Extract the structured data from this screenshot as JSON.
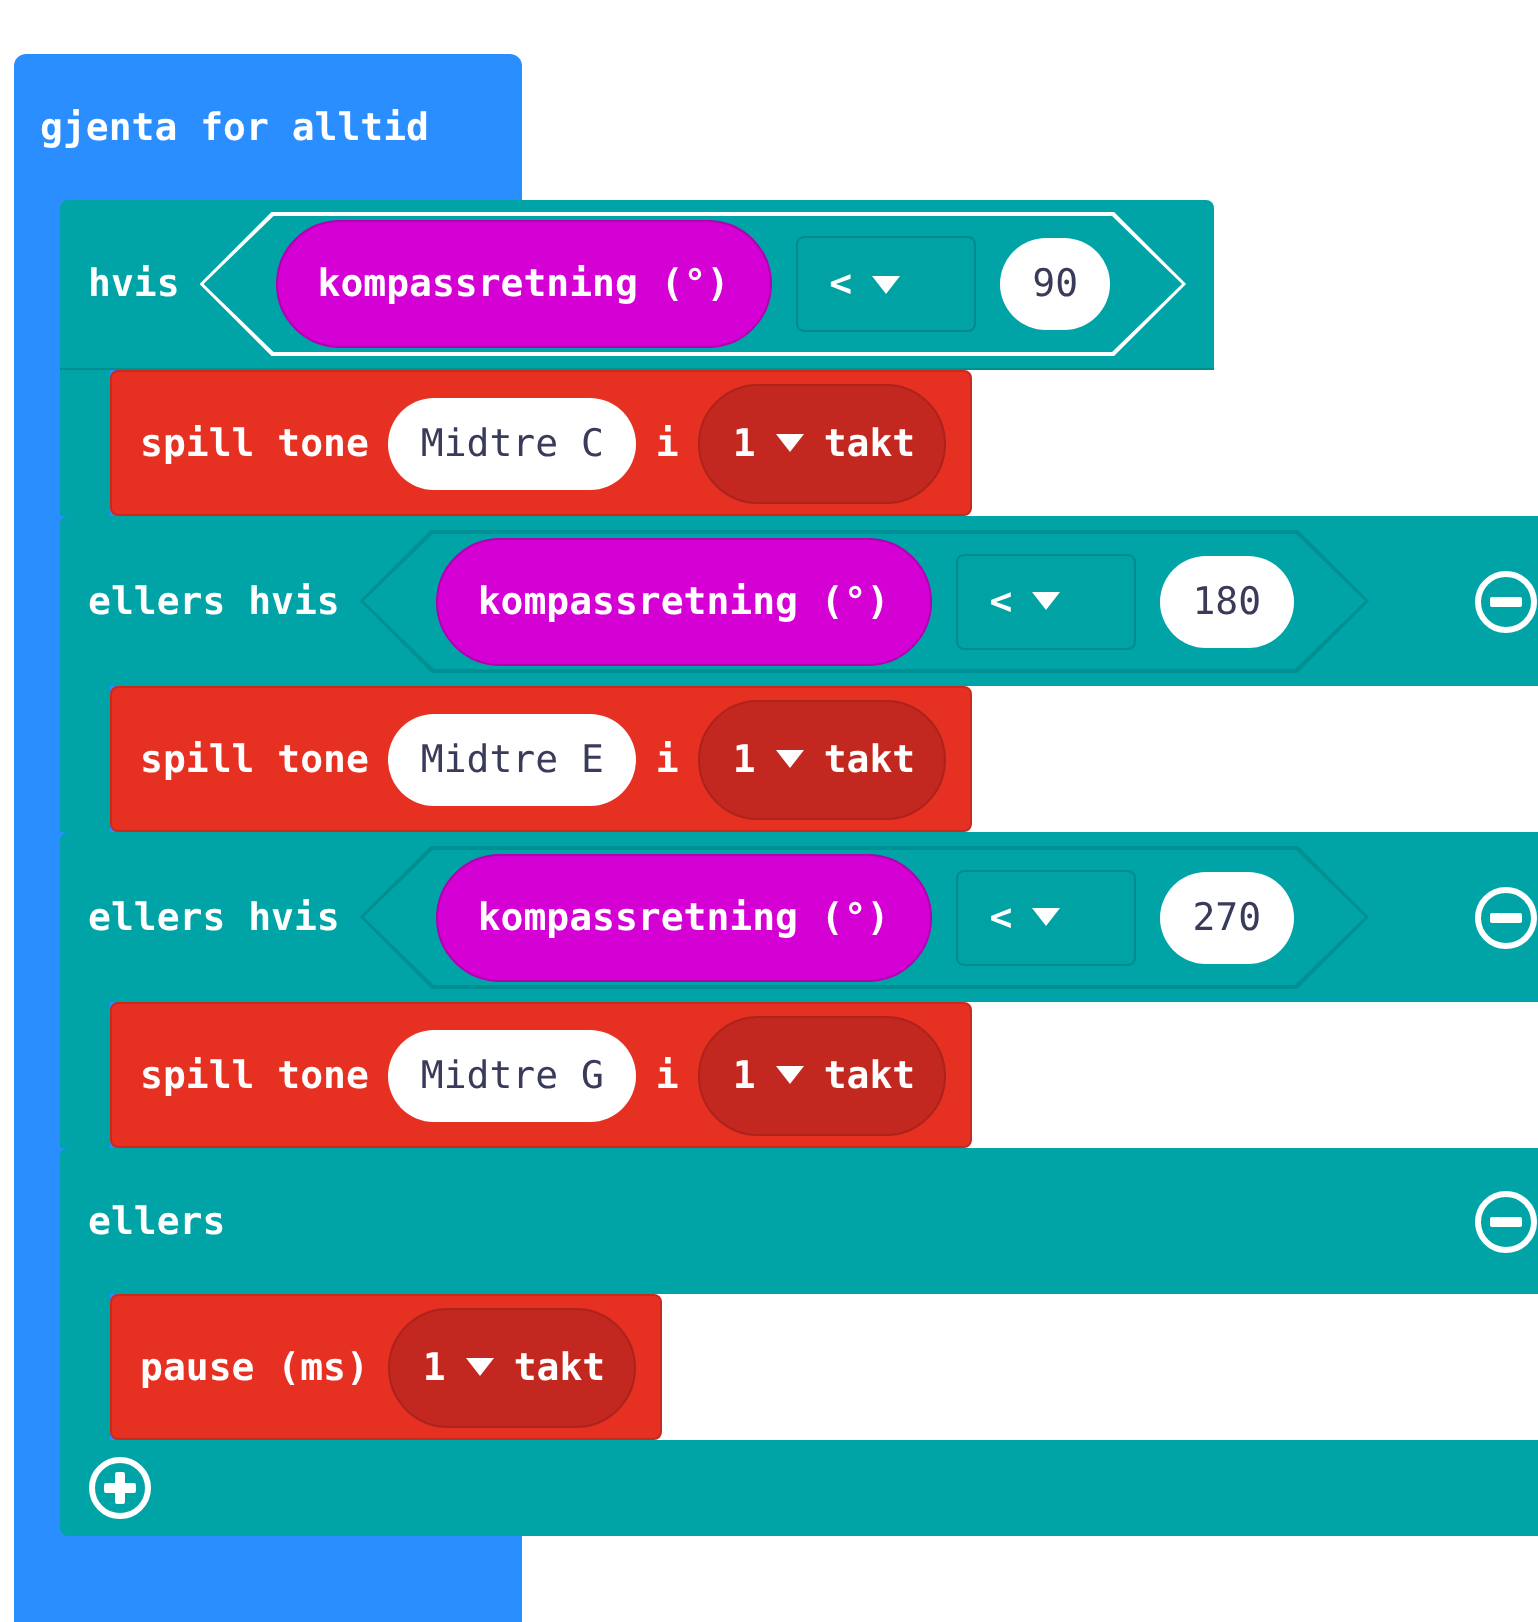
{
  "forever": {
    "label": "gjenta for alltid"
  },
  "if_block": {
    "branches": [
      {
        "kind": "if",
        "label": "hvis",
        "removable": false,
        "condition": {
          "sensor": "kompassretning (°)",
          "operator": "<",
          "value": "90",
          "highlighted": true
        },
        "statement": {
          "kind": "tone",
          "label": "spill tone",
          "note": "Midtre C",
          "connector": "i",
          "beats": "1",
          "unit": "takt"
        }
      },
      {
        "kind": "elseif",
        "label": "ellers hvis",
        "removable": true,
        "condition": {
          "sensor": "kompassretning (°)",
          "operator": "<",
          "value": "180",
          "highlighted": false
        },
        "statement": {
          "kind": "tone",
          "label": "spill tone",
          "note": "Midtre E",
          "connector": "i",
          "beats": "1",
          "unit": "takt"
        }
      },
      {
        "kind": "elseif",
        "label": "ellers hvis",
        "removable": true,
        "condition": {
          "sensor": "kompassretning (°)",
          "operator": "<",
          "value": "270",
          "highlighted": false
        },
        "statement": {
          "kind": "tone",
          "label": "spill tone",
          "note": "Midtre G",
          "connector": "i",
          "beats": "1",
          "unit": "takt"
        }
      },
      {
        "kind": "else",
        "label": "ellers",
        "removable": true,
        "statement": {
          "kind": "pause",
          "label": "pause (ms)",
          "beats": "1",
          "unit": "takt"
        }
      }
    ],
    "add_button": true
  }
}
